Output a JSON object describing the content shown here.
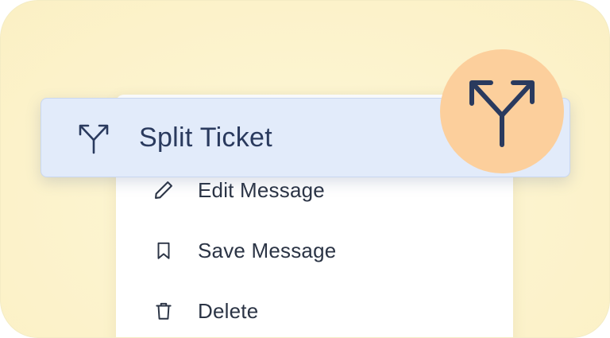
{
  "menu": {
    "highlighted": {
      "label": "Split Ticket",
      "icon": "split-arrows-icon"
    },
    "items": [
      {
        "label": "Edit Message",
        "icon": "pencil-icon"
      },
      {
        "label": "Save Message",
        "icon": "bookmark-icon"
      },
      {
        "label": "Delete",
        "icon": "trash-icon"
      }
    ]
  },
  "badge": {
    "icon": "split-arrows-icon"
  },
  "colors": {
    "background": "#fcf3cd",
    "highlight": "#e2ebfa",
    "badge": "#fccf9c",
    "text": "#2b3445",
    "highlight_text": "#2a3a5e"
  }
}
